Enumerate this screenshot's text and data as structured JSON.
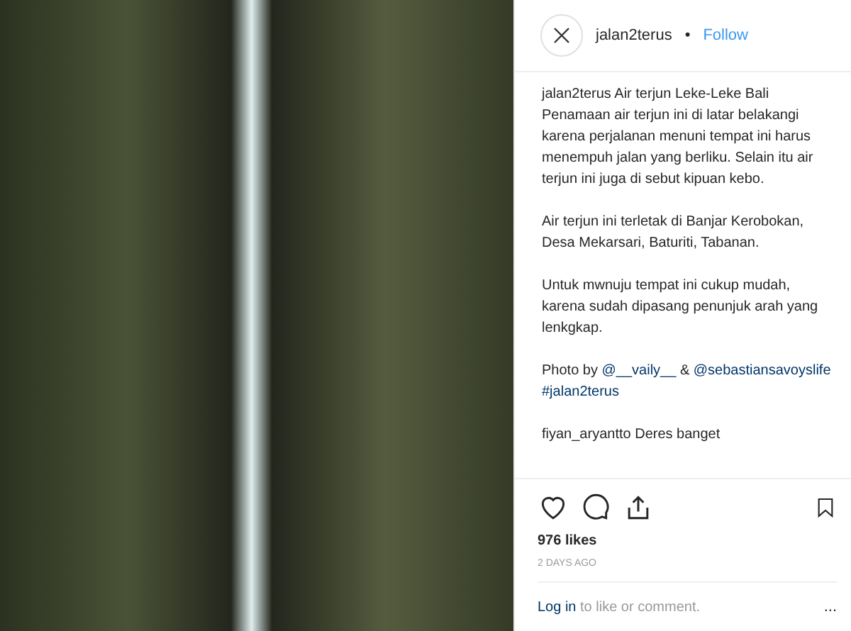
{
  "post": {
    "username": "jalan2terus",
    "separator": "•",
    "follow": "Follow"
  },
  "caption": {
    "username": "jalan2terus",
    "paragraphs": [
      [
        {
          "kind": "text",
          "text": "Air terjun Leke-Leke Bali Penamaan air terjun ini di latar belakangi karena perjalanan menuni tempat ini harus menempuh jalan yang berliku. Selain itu air terjun ini juga di sebut kipuan kebo."
        }
      ],
      [
        {
          "kind": "text",
          "text": "Air terjun ini terletak di Banjar Kerobokan, Desa Mekarsari, Baturiti, Tabanan."
        }
      ],
      [
        {
          "kind": "text",
          "text": "Untuk mwnuju tempat ini cukup mudah, karena sudah dipasang penunjuk arah yang lenkgkap."
        }
      ],
      [
        {
          "kind": "text",
          "text": "Photo by "
        },
        {
          "kind": "link",
          "text": "@__vaily__"
        },
        {
          "kind": "text",
          "text": " & "
        },
        {
          "kind": "link",
          "text": "@sebastiansavoyslife"
        },
        {
          "kind": "break"
        },
        {
          "kind": "link",
          "text": "#jalan2terus"
        }
      ]
    ]
  },
  "comments": [
    {
      "username": "fiyan_aryantto",
      "text": "Deres banget"
    }
  ],
  "likes": "976 likes",
  "time": "2 DAYS AGO",
  "login": {
    "link": "Log in",
    "text": "to like or comment.",
    "more": "..."
  }
}
